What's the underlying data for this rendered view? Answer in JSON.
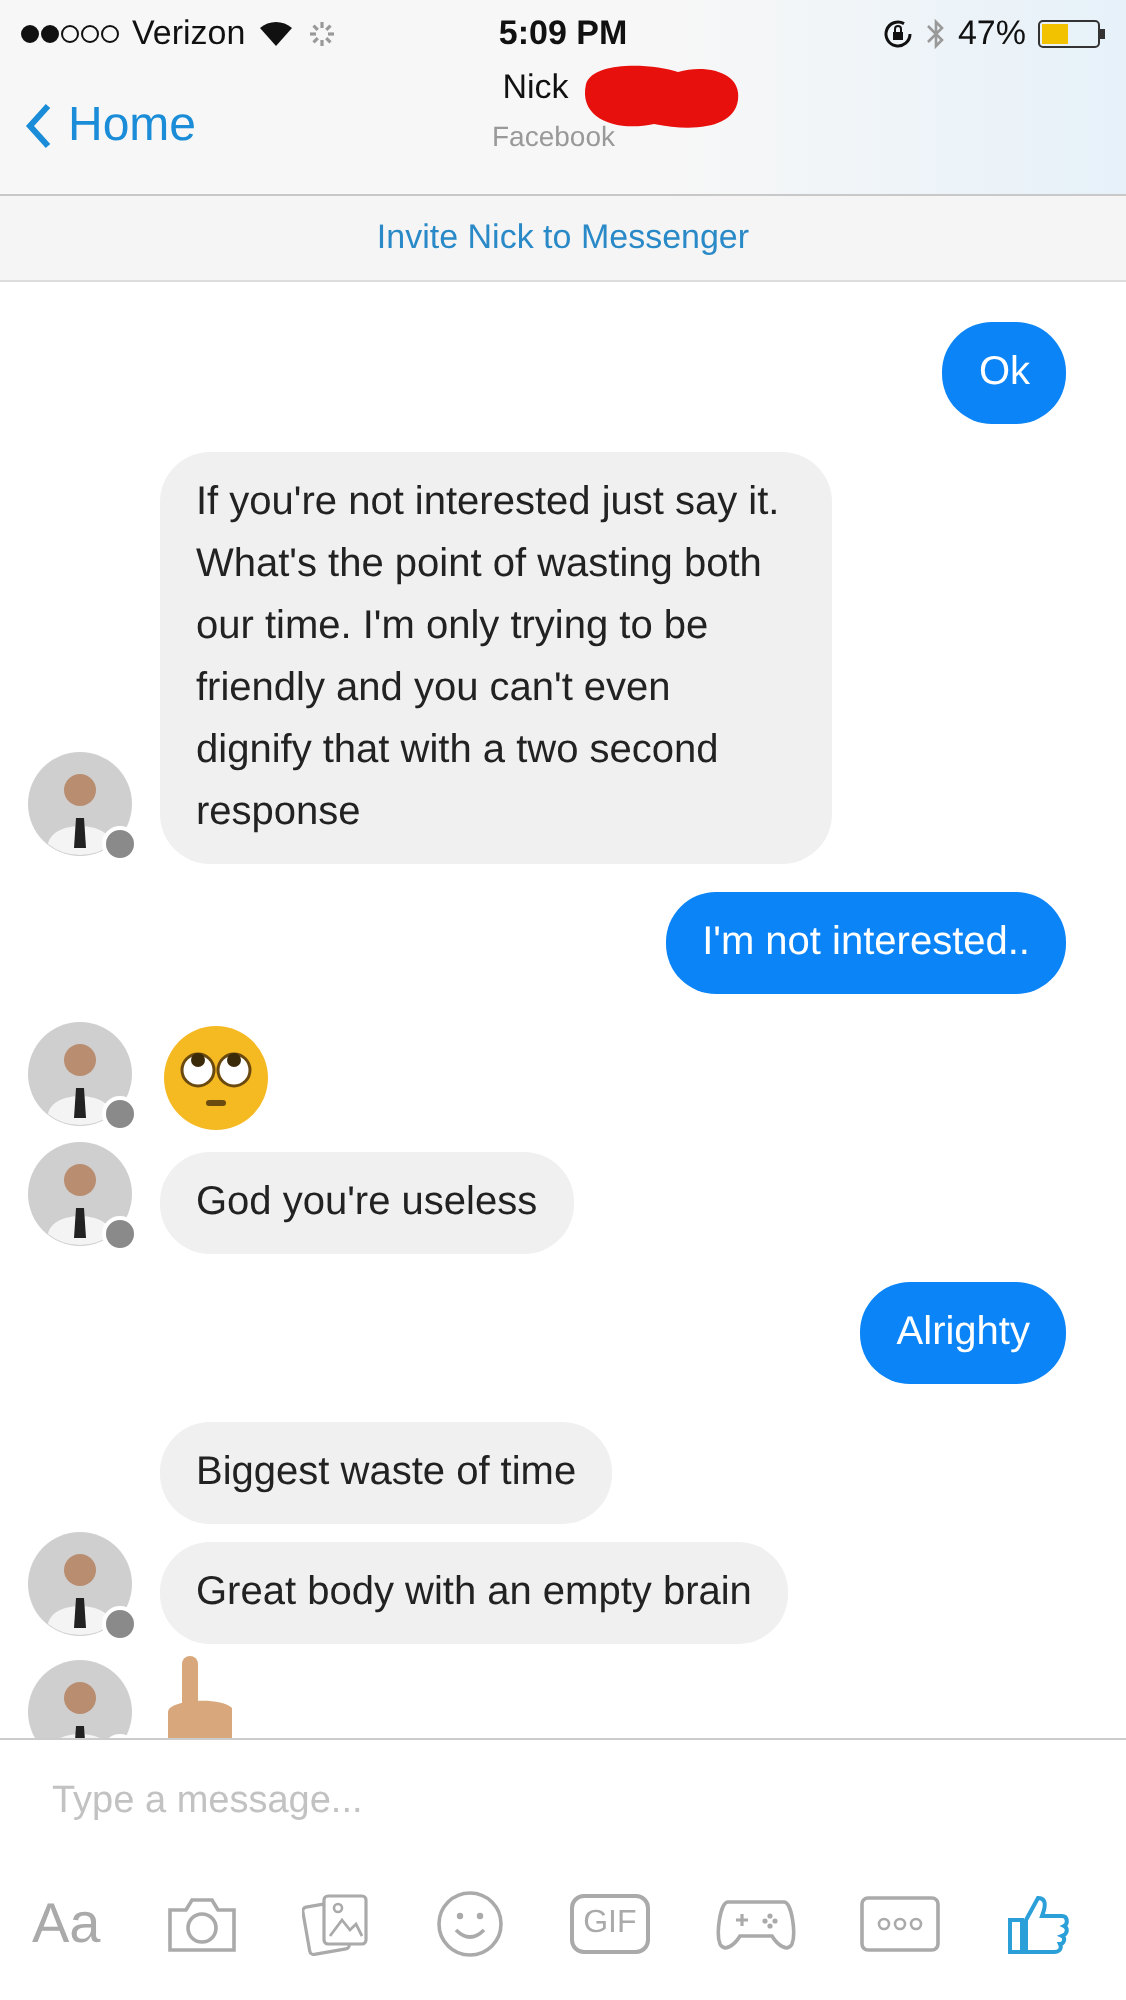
{
  "status_bar": {
    "carrier": "Verizon",
    "time": "5:09 PM",
    "battery": "47%"
  },
  "header": {
    "back": "Home",
    "name": "Nick",
    "subtitle": "Facebook"
  },
  "invite_bar": {
    "text": "Invite Nick to Messenger"
  },
  "messages": [
    {
      "kind": "sent_text",
      "text": "Ok"
    },
    {
      "kind": "received_text",
      "text": "If you're not interested just say it. What's the point of wasting both our time. I'm only trying to be friendly and you can't even dignify that with a two second response",
      "avatar": true
    },
    {
      "kind": "sent_text",
      "text": "I'm not interested.."
    },
    {
      "kind": "received_eyeroll",
      "avatar": true
    },
    {
      "kind": "received_text",
      "text": "God you're useless",
      "avatar": true
    },
    {
      "kind": "sent_text",
      "text": "Alrighty"
    },
    {
      "kind": "received_text",
      "text": "Biggest waste of time",
      "avatar": false
    },
    {
      "kind": "received_text",
      "text": "Great body with an empty brain",
      "avatar": true
    },
    {
      "kind": "received_hand",
      "avatar": true
    }
  ],
  "composer": {
    "placeholder": "Type a message..."
  },
  "toolbar": {
    "text_button": "Aa",
    "gif_button": "GIF"
  }
}
